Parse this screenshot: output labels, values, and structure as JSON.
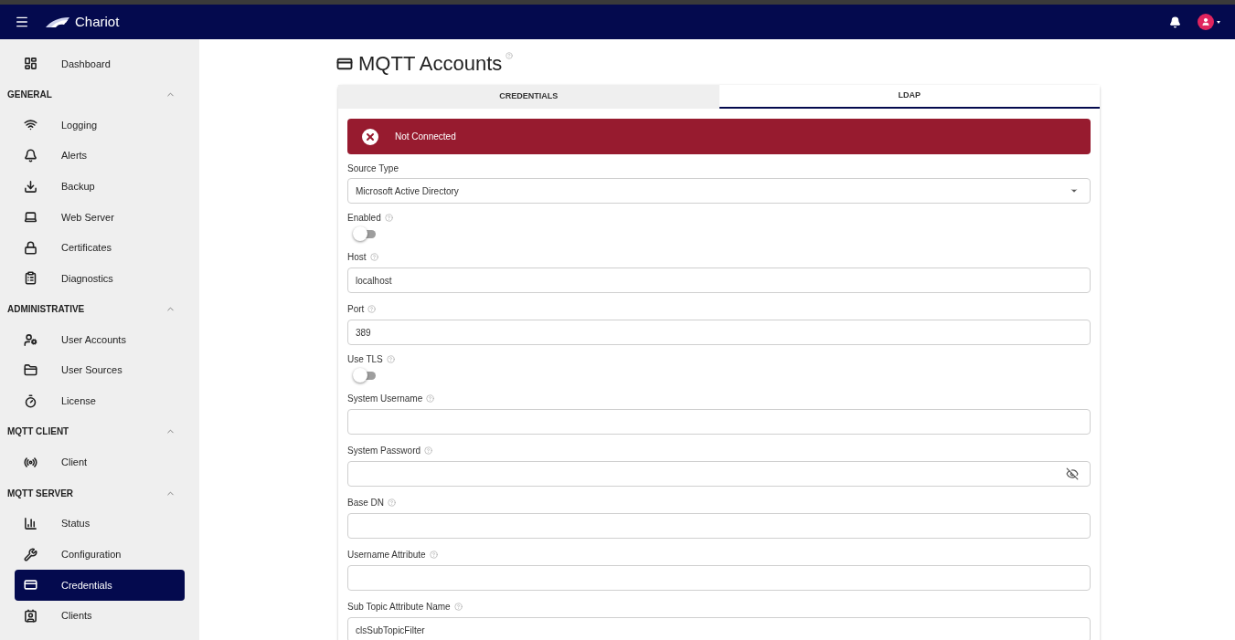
{
  "app": {
    "title": "Chariot"
  },
  "sidebar": {
    "items": [
      {
        "kind": "item",
        "label": "Dashboard",
        "selected": false
      },
      {
        "kind": "section",
        "label": "GENERAL",
        "expanded": true,
        "children": [
          {
            "label": "Logging",
            "selected": false
          },
          {
            "label": "Alerts",
            "selected": false
          },
          {
            "label": "Backup",
            "selected": false
          },
          {
            "label": "Web Server",
            "selected": false
          },
          {
            "label": "Certificates",
            "selected": false
          },
          {
            "label": "Diagnostics",
            "selected": false
          }
        ]
      },
      {
        "kind": "section",
        "label": "ADMINISTRATIVE",
        "expanded": true,
        "children": [
          {
            "label": "User Accounts",
            "selected": false
          },
          {
            "label": "User Sources",
            "selected": false
          },
          {
            "label": "License",
            "selected": false
          }
        ]
      },
      {
        "kind": "section",
        "label": "MQTT CLIENT",
        "expanded": true,
        "children": [
          {
            "label": "Client",
            "selected": false
          }
        ]
      },
      {
        "kind": "section",
        "label": "MQTT SERVER",
        "expanded": true,
        "children": [
          {
            "label": "Status",
            "selected": false
          },
          {
            "label": "Configuration",
            "selected": false
          },
          {
            "label": "Credentials",
            "selected": true
          },
          {
            "label": "Clients",
            "selected": false
          }
        ]
      }
    ]
  },
  "page": {
    "title": "MQTT Accounts"
  },
  "tabs": [
    {
      "label": "CREDENTIALS",
      "selected": false
    },
    {
      "label": "LDAP",
      "selected": true
    }
  ],
  "alert": {
    "text": "Not Connected"
  },
  "fields": [
    {
      "kind": "select",
      "label": "Source Type",
      "help": false,
      "value": "Microsoft Active Directory"
    },
    {
      "kind": "toggle",
      "label": "Enabled",
      "help": true,
      "on": false
    },
    {
      "kind": "text",
      "label": "Host",
      "help": true,
      "value": "localhost"
    },
    {
      "kind": "text",
      "label": "Port",
      "help": true,
      "value": "389"
    },
    {
      "kind": "toggle",
      "label": "Use TLS",
      "help": true,
      "on": false
    },
    {
      "kind": "text",
      "label": "System Username",
      "help": true
    },
    {
      "kind": "password",
      "label": "System Password",
      "help": true
    },
    {
      "kind": "text",
      "label": "Base DN",
      "help": true
    },
    {
      "kind": "text",
      "label": "Username Attribute",
      "help": true
    },
    {
      "kind": "text",
      "label": "Sub Topic Attribute Name",
      "help": true,
      "value": "clsSubTopicFilter"
    }
  ]
}
